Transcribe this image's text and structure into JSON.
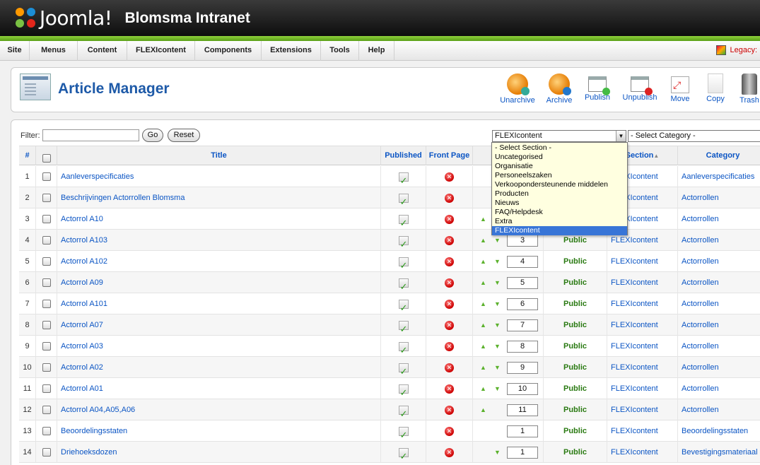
{
  "header": {
    "logo_text": "Joomla!",
    "site_title": "Blomsma Intranet"
  },
  "menu": {
    "items": [
      "Site",
      "Menus",
      "Content",
      "FLEXIcontent",
      "Components",
      "Extensions",
      "Tools",
      "Help"
    ],
    "legacy": "Legacy:"
  },
  "toolbar": {
    "title": "Article Manager",
    "buttons": [
      "Unarchive",
      "Archive",
      "Publish",
      "Unpublish",
      "Move",
      "Copy",
      "Trash"
    ]
  },
  "filter": {
    "label": "Filter:",
    "value": "",
    "go": "Go",
    "reset": "Reset",
    "section_selected": "FLEXIcontent",
    "category_selected": "- Select Category -"
  },
  "section_dropdown": {
    "options": [
      "- Select Section -",
      "Uncategorised",
      "Organisatie",
      "Personeelszaken",
      "Verkoopondersteunende middelen",
      "Producten",
      "Nieuws",
      "FAQ/Helpdesk",
      "Extra",
      "FLEXIcontent"
    ],
    "highlighted": "FLEXIcontent"
  },
  "table": {
    "headers": {
      "num": "#",
      "title": "Title",
      "published": "Published",
      "front_page": "Front Page",
      "section": "Section",
      "category": "Category"
    },
    "rows": [
      {
        "num": "1",
        "title": "Aanleverspecificaties",
        "order": "",
        "access": "",
        "section": "FLEXIcontent",
        "category": "Aanleverspecificaties",
        "up": false,
        "down": false
      },
      {
        "num": "2",
        "title": "Beschrijvingen Actorrollen Blomsma",
        "order": "",
        "access": "",
        "section": "FLEXIcontent",
        "category": "Actorrollen",
        "up": false,
        "down": false
      },
      {
        "num": "3",
        "title": "Actorrol A10",
        "order": "",
        "access": "",
        "section": "FLEXIcontent",
        "category": "Actorrollen",
        "up": true,
        "down": false
      },
      {
        "num": "4",
        "title": "Actorrol A103",
        "order": "3",
        "access": "Public",
        "section": "FLEXIcontent",
        "category": "Actorrollen",
        "up": true,
        "down": true
      },
      {
        "num": "5",
        "title": "Actorrol A102",
        "order": "4",
        "access": "Public",
        "section": "FLEXIcontent",
        "category": "Actorrollen",
        "up": true,
        "down": true
      },
      {
        "num": "6",
        "title": "Actorrol A09",
        "order": "5",
        "access": "Public",
        "section": "FLEXIcontent",
        "category": "Actorrollen",
        "up": true,
        "down": true
      },
      {
        "num": "7",
        "title": "Actorrol A101",
        "order": "6",
        "access": "Public",
        "section": "FLEXIcontent",
        "category": "Actorrollen",
        "up": true,
        "down": true
      },
      {
        "num": "8",
        "title": "Actorrol A07",
        "order": "7",
        "access": "Public",
        "section": "FLEXIcontent",
        "category": "Actorrollen",
        "up": true,
        "down": true
      },
      {
        "num": "9",
        "title": "Actorrol A03",
        "order": "8",
        "access": "Public",
        "section": "FLEXIcontent",
        "category": "Actorrollen",
        "up": true,
        "down": true
      },
      {
        "num": "10",
        "title": "Actorrol A02",
        "order": "9",
        "access": "Public",
        "section": "FLEXIcontent",
        "category": "Actorrollen",
        "up": true,
        "down": true
      },
      {
        "num": "11",
        "title": "Actorrol A01",
        "order": "10",
        "access": "Public",
        "section": "FLEXIcontent",
        "category": "Actorrollen",
        "up": true,
        "down": true
      },
      {
        "num": "12",
        "title": "Actorrol A04,A05,A06",
        "order": "11",
        "access": "Public",
        "section": "FLEXIcontent",
        "category": "Actorrollen",
        "up": true,
        "down": false
      },
      {
        "num": "13",
        "title": "Beoordelingsstaten",
        "order": "1",
        "access": "Public",
        "section": "FLEXIcontent",
        "category": "Beoordelingsstaten",
        "up": false,
        "down": false
      },
      {
        "num": "14",
        "title": "Driehoeksdozen",
        "order": "1",
        "access": "Public",
        "section": "FLEXIcontent",
        "category": "Bevestigingsmateriaal",
        "up": false,
        "down": true
      }
    ]
  },
  "colors": {
    "link": "#0b55c4",
    "title_blue": "#1e5aa8",
    "header_green": "#6fb526",
    "public_green": "#2a7a12"
  }
}
